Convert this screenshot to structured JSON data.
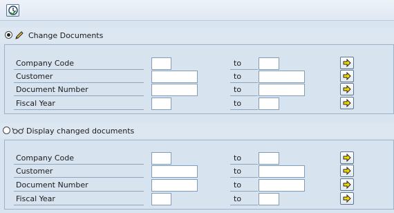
{
  "toolbar": {
    "execute_icon": "execute-clock-icon"
  },
  "sections": [
    {
      "title": "Change Documents",
      "selected": true,
      "icon": "pencil-icon",
      "fields": [
        {
          "label": "Company Code",
          "to_label": "to",
          "from_value": "",
          "to_value": ""
        },
        {
          "label": "Customer",
          "to_label": "to",
          "from_value": "",
          "to_value": ""
        },
        {
          "label": "Document Number",
          "to_label": "to",
          "from_value": "",
          "to_value": ""
        },
        {
          "label": "Fiscal Year",
          "to_label": "to",
          "from_value": "",
          "to_value": ""
        }
      ]
    },
    {
      "title": "Display changed documents",
      "selected": false,
      "icon": "glasses-icon",
      "fields": [
        {
          "label": "Company Code",
          "to_label": "to",
          "from_value": "",
          "to_value": ""
        },
        {
          "label": "Customer",
          "to_label": "to",
          "from_value": "",
          "to_value": ""
        },
        {
          "label": "Document Number",
          "to_label": "to",
          "from_value": "",
          "to_value": ""
        },
        {
          "label": "Fiscal Year",
          "to_label": "to",
          "from_value": "",
          "to_value": ""
        }
      ]
    }
  ],
  "colors": {
    "background": "#d9e4f1",
    "multi_select_arrow": "#f5d800"
  }
}
